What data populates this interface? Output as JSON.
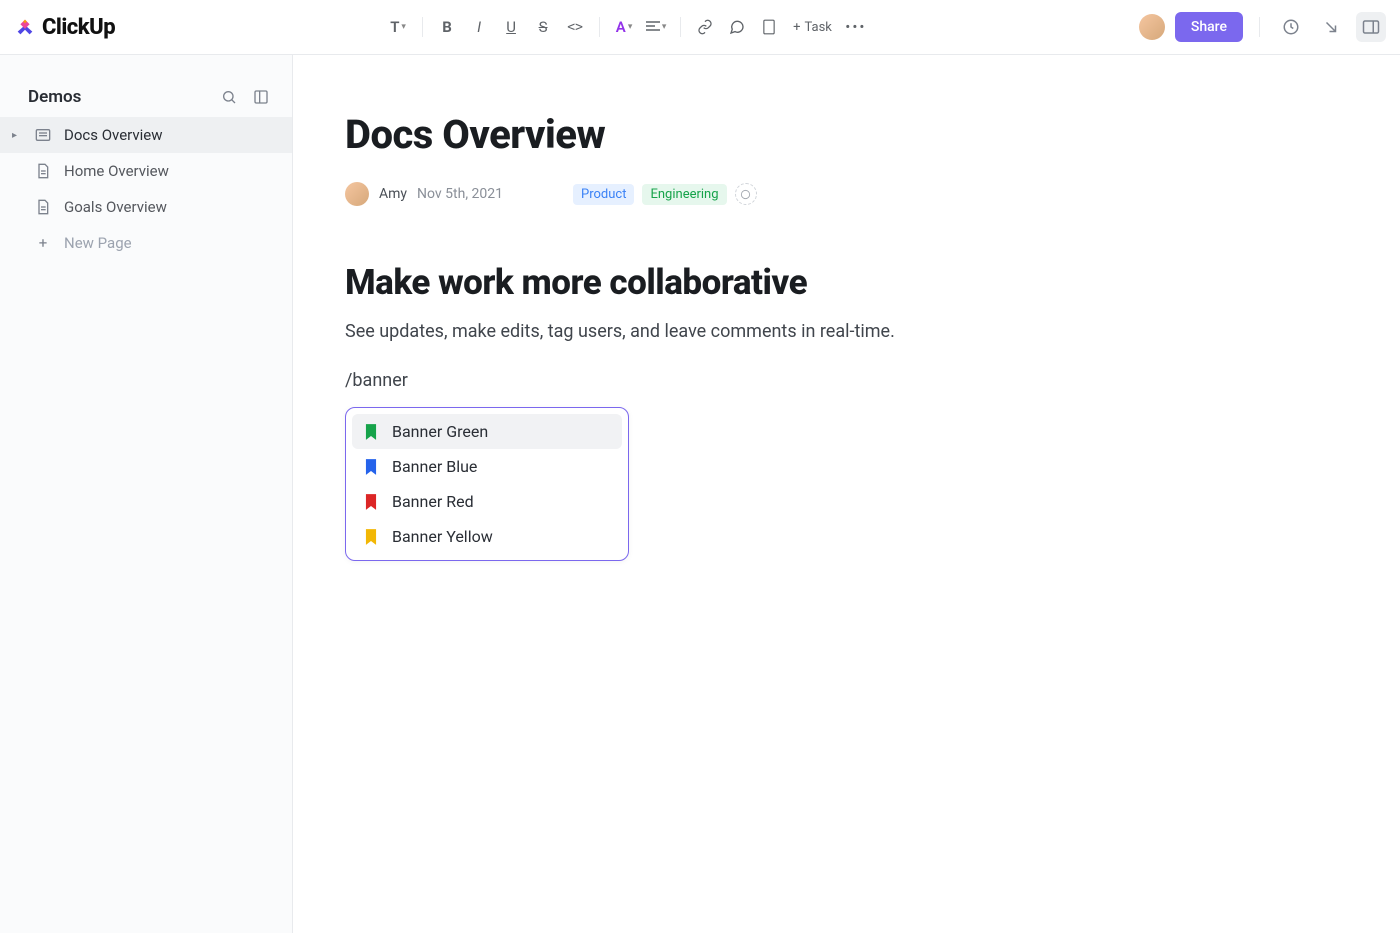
{
  "brand": "ClickUp",
  "toolbar": {
    "text_style": "T",
    "bold": "B",
    "italic": "I",
    "task_label": "Task",
    "share_label": "Share"
  },
  "sidebar": {
    "title": "Demos",
    "items": [
      {
        "label": "Docs Overview",
        "active": true,
        "icon": "doc"
      },
      {
        "label": "Home Overview",
        "active": false,
        "icon": "page"
      },
      {
        "label": "Goals Overview",
        "active": false,
        "icon": "page"
      }
    ],
    "new_page_label": "New Page"
  },
  "page": {
    "title": "Docs Overview",
    "author": "Amy",
    "date": "Nov 5th, 2021",
    "tags": [
      {
        "label": "Product",
        "cls": "product"
      },
      {
        "label": "Engineering",
        "cls": "engineering"
      }
    ],
    "section_title": "Make work more collaborative",
    "section_text": "See updates, make edits, tag users, and leave comments in real-time.",
    "slash_command": "/banner"
  },
  "dropdown": {
    "items": [
      {
        "label": "Banner Green",
        "color": "#16a34a",
        "selected": true
      },
      {
        "label": "Banner Blue",
        "color": "#2563eb",
        "selected": false
      },
      {
        "label": "Banner Red",
        "color": "#dc2626",
        "selected": false
      },
      {
        "label": "Banner Yellow",
        "color": "#f2b705",
        "selected": false
      }
    ]
  }
}
